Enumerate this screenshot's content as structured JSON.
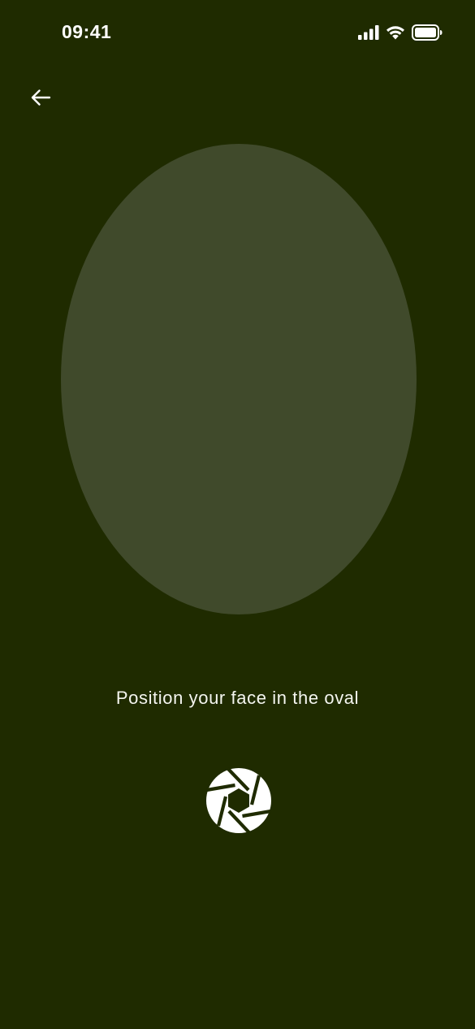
{
  "status_bar": {
    "time": "09:41",
    "icons": [
      "cellular-signal-icon",
      "wifi-icon",
      "battery-icon"
    ]
  },
  "navigation": {
    "back_icon": "arrow-left-icon"
  },
  "camera": {
    "instruction": "Position your face in the oval",
    "shutter_icon": "camera-aperture-icon"
  },
  "colors": {
    "background": "#1f2b00",
    "oval": "#404a2b",
    "foreground": "#ffffff"
  }
}
